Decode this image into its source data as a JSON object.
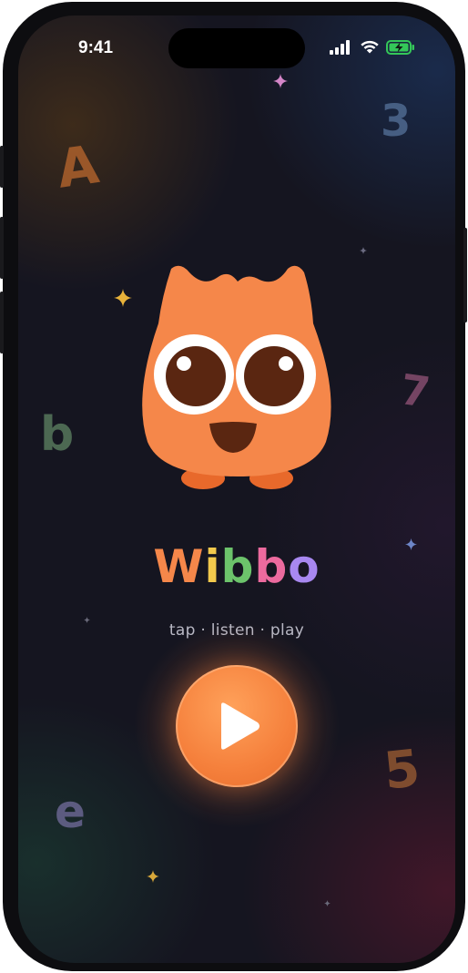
{
  "status_bar": {
    "time": "9:41",
    "signal_icon": "cellular-signal-icon",
    "wifi_icon": "wifi-icon",
    "battery_icon": "battery-charging-icon",
    "battery_color": "#34c759"
  },
  "floating_letters": [
    "A",
    "3",
    "b",
    "7",
    "e",
    "5"
  ],
  "mascot": {
    "icon": "owl-mascot-icon",
    "body_color": "#f5874a"
  },
  "app": {
    "title_letters": [
      {
        "char": "W",
        "color": "#f5874a"
      },
      {
        "char": "i",
        "color": "#f2c94c"
      },
      {
        "char": "b",
        "color": "#6cc36b"
      },
      {
        "char": "b",
        "color": "#ec6a9e"
      },
      {
        "char": "o",
        "color": "#a888f0"
      }
    ],
    "tagline": "tap · listen · play"
  },
  "play": {
    "icon": "play-icon",
    "color": "#f5803c"
  }
}
